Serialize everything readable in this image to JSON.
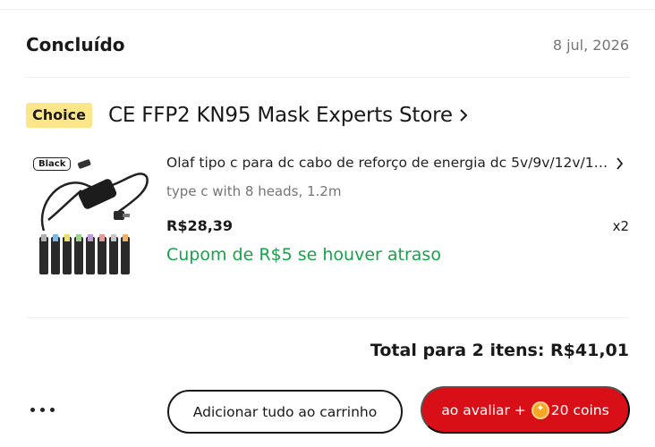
{
  "order": {
    "status": "Concluído",
    "date": "8 jul, 2026"
  },
  "store": {
    "badge": "Choice",
    "name": "CE FFP2 KN95 Mask Experts Store"
  },
  "product": {
    "image_badge": "Black",
    "title": "Olaf tipo c para dc cabo de reforço de energia dc 5v/9v/12v/15v...",
    "variant": "type c with 8 heads, 1.2m",
    "price": "R$28,39",
    "quantity": "x2",
    "coupon": "Cupom de R$5 se houver atraso"
  },
  "summary": {
    "total": "Total para 2 itens: R$41,01"
  },
  "actions": {
    "add_all_to_cart": "Adicionar tudo ao carrinho",
    "review_prefix": "ao avaliar +",
    "review_coins": "20 coins"
  },
  "colors": {
    "accent_red": "#d80f16",
    "coupon_green": "#16a34a",
    "choice_yellow": "#fde68a"
  }
}
